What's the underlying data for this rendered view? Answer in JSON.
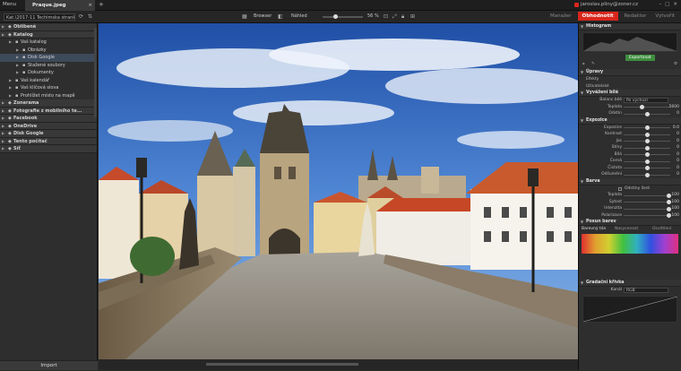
{
  "app": {
    "menu_label": "Menu",
    "active_tab": "Praque.jpeg",
    "user_email": "jaroslav.pliny@zoner.cz",
    "modes": [
      "Manažer",
      "Obhodnotit",
      "Redaktor",
      "Vytvořit"
    ],
    "active_mode_index": 1
  },
  "toolbar": {
    "path": "Kat.\\2017-11 Techimska stranka 04",
    "browse_label": "Browser",
    "preview_label": "Náhled",
    "zoom_level": "56 %"
  },
  "left_panel": {
    "items": [
      {
        "label": "Oblíbené",
        "type": "section"
      },
      {
        "label": "Katalog",
        "type": "section"
      },
      {
        "label": "Vaš katalog",
        "type": "item"
      },
      {
        "label": "Obrázky",
        "type": "item"
      },
      {
        "label": "Disk Google",
        "type": "item"
      },
      {
        "label": "Stažené soubory",
        "type": "item"
      },
      {
        "label": "Dokumenty",
        "type": "item"
      },
      {
        "label": "Vaš kalendář",
        "type": "item"
      },
      {
        "label": "Vaš klíčová slova",
        "type": "item"
      },
      {
        "label": "Prohlížet místo na mapě",
        "type": "item"
      },
      {
        "label": "Zonerama",
        "type": "section"
      },
      {
        "label": "Fotografie z mobilního te...",
        "type": "section"
      },
      {
        "label": "Facebook",
        "type": "section"
      },
      {
        "label": "OneDrive",
        "type": "section"
      },
      {
        "label": "Disk Google",
        "type": "section"
      },
      {
        "label": "Tento počítač",
        "type": "section"
      },
      {
        "label": "Síť",
        "type": "section"
      }
    ],
    "import_label": "Import"
  },
  "right_panel": {
    "histogram_title": "Histogram",
    "export_label": "Exportovat",
    "presets": [
      "Úpravy",
      "Efekty",
      "Uživatelské"
    ],
    "white_balance": {
      "title": "Vyvážení bílé",
      "balance_label": "Balanc bílé",
      "balance_value": "Po výchozí",
      "temperature_label": "Teplota",
      "temperature_value": "5600",
      "tint_label": "Odstín",
      "tint_value": "0"
    },
    "exposure": {
      "title": "Expozice",
      "rows": [
        {
          "label": "Expozice",
          "value": "0.0"
        },
        {
          "label": "Kontrast",
          "value": "0"
        },
        {
          "label": "Jas",
          "value": "0"
        },
        {
          "label": "Stíny",
          "value": "0"
        },
        {
          "label": "Bílá",
          "value": "0"
        },
        {
          "label": "Černá",
          "value": "0"
        },
        {
          "label": "Čistota",
          "value": "0"
        },
        {
          "label": "Odšumění",
          "value": "0"
        }
      ]
    },
    "color": {
      "title": "Barva",
      "grayscale_label": "Odstíny šedi",
      "rows": [
        {
          "label": "Teplota",
          "value": "100"
        },
        {
          "label": "Sytost",
          "value": "100"
        },
        {
          "label": "Intenzita",
          "value": "100"
        },
        {
          "label": "Polarizace",
          "value": "100"
        }
      ]
    },
    "color_shift": {
      "title": "Posun barev",
      "tabs": [
        "Barevný tón",
        "Nasycenost",
        "Osvětlení"
      ]
    },
    "curves": {
      "title": "Gradační křivka",
      "channel_label": "Kanál",
      "channel_value": "RGB"
    }
  }
}
